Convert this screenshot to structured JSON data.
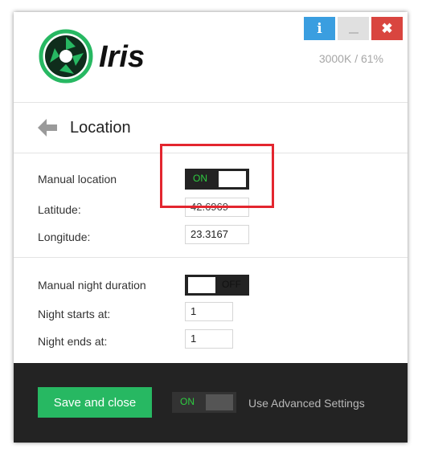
{
  "header": {
    "brand": "Iris",
    "status": "3000K / 61%",
    "info_button": "i",
    "minimize_button": "—",
    "close_button": "✖"
  },
  "section": {
    "title": "Location"
  },
  "location": {
    "manual_location_label": "Manual location",
    "manual_location_state": "ON",
    "latitude_label": "Latitude:",
    "latitude_value": "42.6969",
    "longitude_label": "Longitude:",
    "longitude_value": "23.3167"
  },
  "night": {
    "manual_night_label": "Manual night duration",
    "manual_night_state": "OFF",
    "starts_label": "Night starts at:",
    "starts_value": "1",
    "ends_label": "Night ends at:",
    "ends_value": "1"
  },
  "footer": {
    "save_label": "Save and close",
    "advanced_state": "ON",
    "advanced_label": "Use Advanced Settings"
  },
  "colors": {
    "accent_green": "#27b862",
    "toggle_on_text": "#2ecc40",
    "info_blue": "#3a9ee0",
    "close_red": "#d9453f",
    "highlight_red": "#e3262f"
  },
  "icons": {
    "logo": "aperture-logo-icon",
    "back": "arrow-left-icon",
    "info": "info-icon",
    "minimize": "minimize-icon",
    "close": "close-icon"
  }
}
